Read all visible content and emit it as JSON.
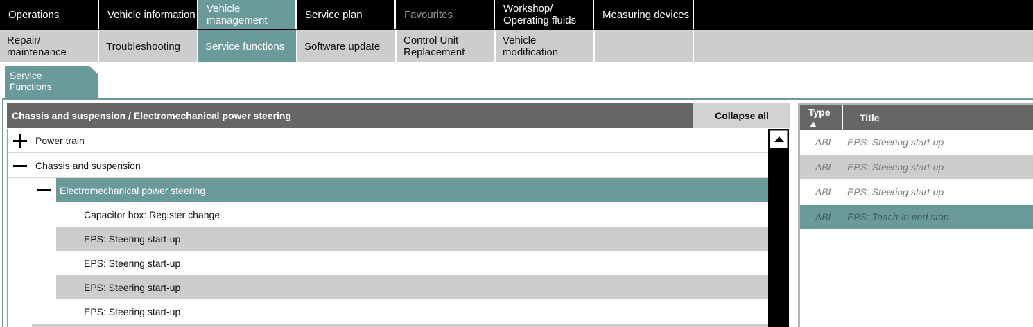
{
  "nav_top": [
    {
      "label": "Operations"
    },
    {
      "label": "Vehicle information"
    },
    {
      "label": "Vehicle\nmanagement"
    },
    {
      "label": "Service plan"
    },
    {
      "label": "Favourites"
    },
    {
      "label": "Workshop/\nOperating fluids"
    },
    {
      "label": "Measuring devices"
    }
  ],
  "nav_sub": [
    {
      "label": "Repair/\nmaintenance"
    },
    {
      "label": "Troubleshooting"
    },
    {
      "label": "Service functions"
    },
    {
      "label": "Software update"
    },
    {
      "label": "Control Unit\nReplacement"
    },
    {
      "label": "Vehicle modification"
    }
  ],
  "service_tab": {
    "label": "Service\nFunctions"
  },
  "left_panel": {
    "breadcrumb": "Chassis and suspension / Electromechanical power steering",
    "collapse_all": "Collapse all",
    "tree": [
      {
        "label": "Power train",
        "icon": "plus-icon"
      },
      {
        "label": "Chassis and suspension",
        "icon": "minus-icon"
      },
      {
        "label": "Electromechanical power steering",
        "icon": "minus-icon"
      },
      {
        "label": "Capacitor box: Register change"
      },
      {
        "label": "EPS: Steering start-up"
      },
      {
        "label": "EPS: Steering start-up"
      },
      {
        "label": "EPS: Steering start-up"
      },
      {
        "label": "EPS: Steering start-up"
      }
    ]
  },
  "right_panel": {
    "columns": {
      "type": "Type ▲",
      "title": "Title"
    },
    "rows": [
      {
        "type": "ABL",
        "title": "EPS: Steering start-up"
      },
      {
        "type": "ABL",
        "title": "EPS: Steering start-up"
      },
      {
        "type": "ABL",
        "title": "EPS: Steering start-up"
      },
      {
        "type": "ABL",
        "title": "EPS: Teach-in end stop"
      }
    ]
  },
  "colors": {
    "accent": "#6a9a9a",
    "header_gray": "#666666",
    "row_alt": "#cdcdcd"
  }
}
